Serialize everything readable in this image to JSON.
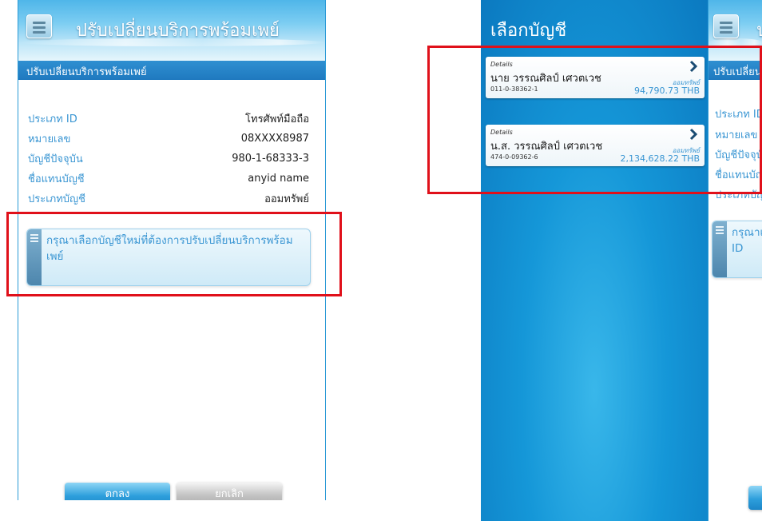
{
  "left_screen": {
    "title": "ปรับเปลี่ยนบริการพร้อมเพย์",
    "subtitle": "ปรับเปลี่ยนบริการพร้อมเพย์",
    "info_rows": [
      {
        "label": "ประเภท ID",
        "value": "โทรศัพท์มือถือ"
      },
      {
        "label": "หมายเลข",
        "value": "08XXXX8987"
      },
      {
        "label": "บัญชีปัจจุบัน",
        "value": "980-1-68333-3"
      },
      {
        "label": "ชื่อแทนบัญชี",
        "value": "anyid name"
      },
      {
        "label": "ประเภทบัญชี",
        "value": "ออมทรัพย์"
      }
    ],
    "select_prompt": "กรุณาเลือกบัญชีใหม่ที่ต้องการปรับเปลี่ยนบริการพร้อมเพย์",
    "ok_label": "ตกลง",
    "cancel_label": "ยกเลิก"
  },
  "right_screen": {
    "drawer_title": "เลือกบัญชี",
    "accounts": [
      {
        "details_label": "Details",
        "name": "นาย วรรณศิลป์ เศวตเวช",
        "number": "011-0-38362-1",
        "type": "ออมทรัพย์",
        "balance": "94,790.73 THB"
      },
      {
        "details_label": "Details",
        "name": "น.ส. วรรณศิลป์ เศวตเวช",
        "number": "474-0-09362-6",
        "type": "ออมทรัพย์",
        "balance": "2,134,628.22 THB"
      }
    ],
    "behind": {
      "title_fragment": "ป",
      "subtitle_fragment": "ปรับเปลี่ยนบ",
      "labels": [
        "ประเภท ID",
        "หมายเลข",
        "บัญชีปัจจุบั",
        "ชื่อแทนบัญ",
        "ประเภทบัญ"
      ],
      "prompt_fragment": "กรุณาเลื",
      "prompt_fragment_2": "ID"
    }
  },
  "colors": {
    "accent_blue": "#3a96d3",
    "header_blue": "#1f79bf",
    "highlight_red": "#e0101a"
  }
}
